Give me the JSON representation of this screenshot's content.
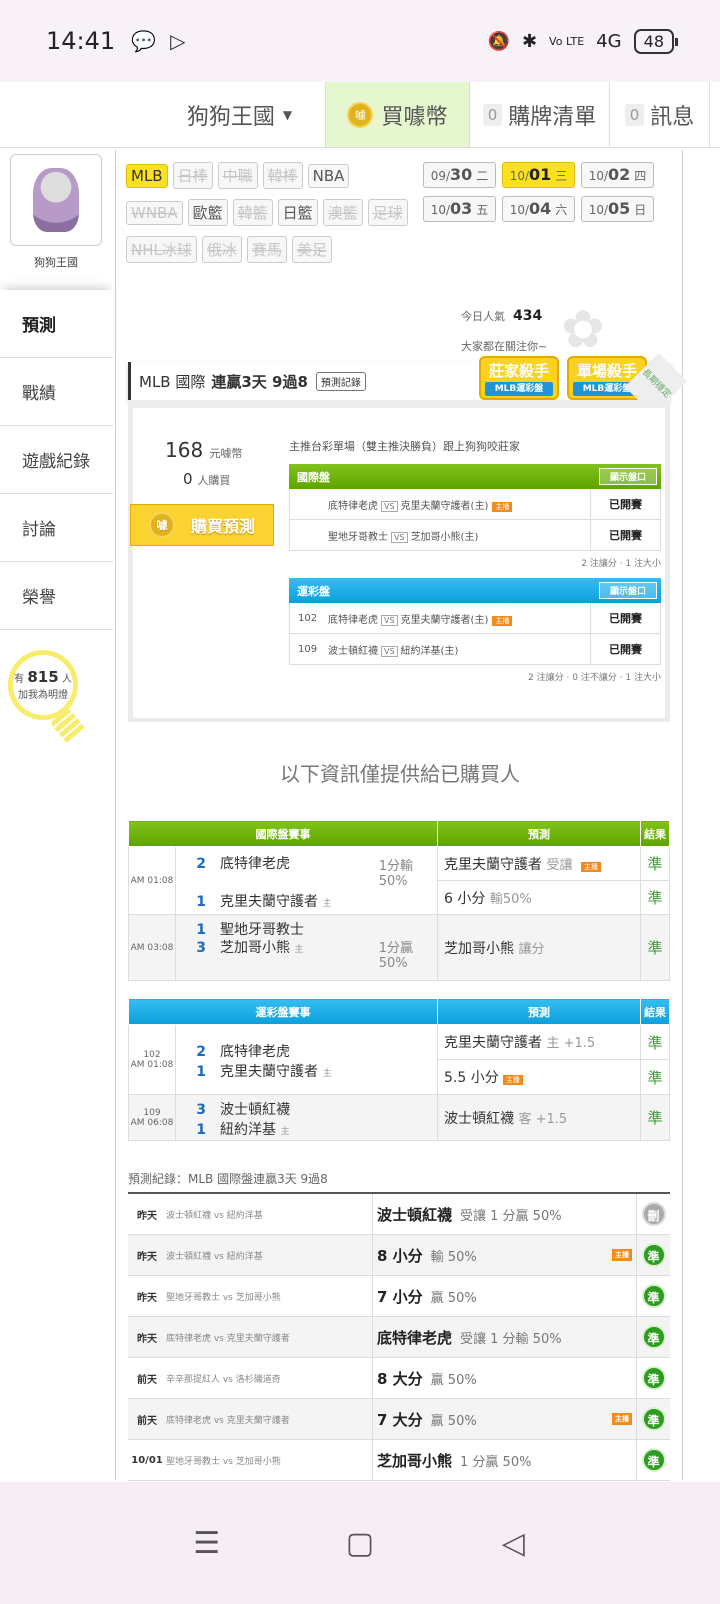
{
  "status": {
    "time": "14:41",
    "battery": "48",
    "signal": "4G",
    "volte": "Vo LTE"
  },
  "topnav": {
    "brand": "狗狗王國",
    "coin": "買噱幣",
    "coin_icon": "噱",
    "list_count": "0",
    "list": "購牌清單",
    "msg_count": "0",
    "msg": "訊息"
  },
  "sidebar": {
    "name": "狗狗王國",
    "items": [
      "預測",
      "戰績",
      "遊戲紀錄",
      "討論",
      "榮譽"
    ],
    "fans_pre": "有",
    "fans": "815",
    "fans_unit": "人",
    "fans_sub": "加我為明燈"
  },
  "tags": [
    [
      "MLB",
      "on"
    ],
    [
      "日棒",
      "dim"
    ],
    [
      "中職",
      "dim"
    ],
    [
      "韓棒",
      "dim"
    ],
    [
      "NBA",
      ""
    ],
    [
      "WNBA",
      "dim"
    ],
    [
      "歐籃",
      ""
    ],
    [
      "韓籃",
      "dim"
    ],
    [
      "日籃",
      ""
    ],
    [
      "澳籃",
      "dim"
    ],
    [
      "足球",
      "dim"
    ],
    [
      "NHL冰球",
      "dim"
    ],
    [
      "俄冰",
      "dim"
    ],
    [
      "賽馬",
      "dim"
    ],
    [
      "美足",
      "dim"
    ]
  ],
  "dates": [
    [
      "09/",
      "30",
      "二",
      ""
    ],
    [
      "10/",
      "01",
      "三",
      "on"
    ],
    [
      "10/",
      "02",
      "四",
      ""
    ],
    [
      "10/",
      "03",
      "五",
      ""
    ],
    [
      "10/",
      "04",
      "六",
      ""
    ],
    [
      "10/",
      "05",
      "日",
      ""
    ]
  ],
  "popularity": {
    "label": "今日人氣",
    "value": "434",
    "sub": "大家都在關注你~"
  },
  "title": {
    "league": "MLB 國際",
    "streak": "連贏3天 9過8",
    "record_btn": "預測記錄",
    "badge1": "莊家殺手",
    "badge1_sub": "MLB運彩盤",
    "badge2": "單場殺手",
    "badge2_sub": "MLB運彩盤",
    "ribbon": "長期穩定"
  },
  "purchase": {
    "price": "168",
    "price_unit": "元噱幣",
    "buyers": "0",
    "buyers_unit": "人購買",
    "buy_btn": "購買預測",
    "desc": "主推台彩單場（雙主推決勝負）跟上狗狗咬莊家"
  },
  "intl": {
    "title": "國際盤",
    "show": "顯示盤口",
    "rows": [
      [
        "",
        "底特律老虎",
        "克里夫蘭守護者(主)",
        "已開賽"
      ],
      [
        "",
        "聖地牙哥教士",
        "芝加哥小熊(主)",
        "已開賽"
      ]
    ],
    "summary": "2 注讓分 · 1 注大小"
  },
  "lottery": {
    "title": "運彩盤",
    "show": "顯示盤口",
    "rows": [
      [
        "102",
        "底特律老虎",
        "克里夫蘭守護者(主)",
        "已開賽"
      ],
      [
        "109",
        "波士頓紅襪",
        "紐約洋基(主)",
        "已開賽"
      ]
    ],
    "summary": "2 注讓分 · 0 注不讓分 · 1 注大小"
  },
  "notice": "以下資訊僅提供給已購買人",
  "table1": {
    "h1": "國際盤賽事",
    "h2": "預測",
    "h3": "結果"
  },
  "table2": {
    "h1": "運彩盤賽事",
    "h2": "預測",
    "h3": "結果"
  },
  "t1": {
    "time1": "AM 01:08",
    "s1a": "2",
    "n1a": "底特律老虎",
    "h1": "1分輸",
    "h1b": "50%",
    "s1b": "1",
    "n1b": "克里夫蘭守護者",
    "p1a": "克里夫蘭守護者",
    "p1a_sub": "受讓",
    "p1b": "6 小分",
    "p1b_sub": "輸50%",
    "time2": "AM 03:08",
    "s2a": "1",
    "n2a": "聖地牙哥教士",
    "s2b": "3",
    "n2b": "芝加哥小熊",
    "h2": "1分贏",
    "h2b": "50%",
    "p2": "芝加哥小熊",
    "p2_sub": "讓分",
    "r": "準"
  },
  "t2": {
    "no1": "102",
    "time1": "AM 01:08",
    "s1a": "2",
    "n1a": "底特律老虎",
    "s1b": "1",
    "n1b": "克里夫蘭守護者",
    "p1a": "克里夫蘭守護者",
    "p1a_sub": "主 +1.5",
    "p1b": "5.5 小分",
    "no2": "109",
    "time2": "AM 06:08",
    "s2a": "3",
    "n2a": "波士頓紅襪",
    "s2b": "1",
    "n2b": "紐約洋基",
    "p2": "波士頓紅襪",
    "p2_sub": "客 +1.5",
    "r": "準"
  },
  "history_label": "預測紀錄：MLB 國際盤連贏3天 9過8",
  "history": [
    [
      "昨天",
      "波士頓紅襪 vs 紐約洋基",
      "波士頓紅襪",
      "受讓 1 分贏 50%",
      "",
      "刪"
    ],
    [
      "昨天",
      "波士頓紅襪 vs 紐約洋基",
      "8 小分",
      "輸 50%",
      "tv",
      "準"
    ],
    [
      "昨天",
      "聖地牙哥教士 vs 芝加哥小熊",
      "7 小分",
      "贏 50%",
      "",
      "準"
    ],
    [
      "昨天",
      "底特律老虎 vs 克里夫蘭守護者",
      "底特律老虎",
      "受讓 1 分輸 50%",
      "",
      "準"
    ],
    [
      "前天",
      "辛辛那提紅人 vs 洛杉磯道奇",
      "8 大分",
      "贏 50%",
      "",
      "準"
    ],
    [
      "前天",
      "底特律老虎 vs 克里夫蘭守護者",
      "7 大分",
      "贏 50%",
      "tv",
      "準"
    ],
    [
      "10/01",
      "聖地牙哥教士 vs 芝加哥小熊",
      "芝加哥小熊",
      "1 分贏 50%",
      "",
      "準"
    ]
  ],
  "tv_label": "主播",
  "home_mark": "主",
  "vs_label": "VS",
  "nav": {
    "menu": "☰",
    "home": "▢",
    "back": "◁"
  }
}
